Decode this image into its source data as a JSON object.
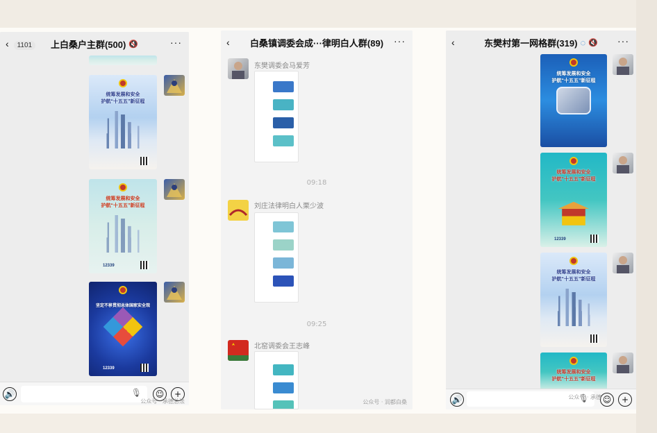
{
  "colors": {
    "background": "#f3eee6",
    "chat_bg": "#ededed",
    "nav_text": "#111111",
    "secondary_text": "#8a8a8a"
  },
  "left_chat": {
    "back_badge": "1101",
    "title": "上白桑户主群(500)",
    "more_label": "···",
    "posters": [
      {
        "style": "city",
        "line1": "统筹发展和安全",
        "line2": "护航“十五五”新征程"
      },
      {
        "style": "scroll",
        "line1": "统筹发展和安全",
        "line2": "护航“十五五”新征程",
        "hotline": "12339"
      },
      {
        "style": "cube",
        "line1": "坚定不移贯彻总体国家安全观",
        "hotline": "12339"
      }
    ],
    "watermark": "公众号 · 承德总法"
  },
  "mid_chat": {
    "title": "白桑镇调委会成···律明白人群(89)",
    "more_label": "···",
    "messages": [
      {
        "sender": "东樊调委会马爱芳"
      },
      {
        "time": "09:18"
      },
      {
        "sender": "刘庄法律明白人栗少波"
      },
      {
        "time": "09:25"
      },
      {
        "sender": "北窑调委会王志峰"
      }
    ],
    "watermark": "公众号 · 润都白桑"
  },
  "right_chat": {
    "title": "东樊村第一网格群(319)",
    "more_label": "···",
    "posters": [
      {
        "style": "robot",
        "line1": "统筹发展和安全",
        "line2": "护航“十五五”新征程"
      },
      {
        "style": "teal",
        "line1": "统筹发展和安全",
        "line2": "护航“十五五”新征程",
        "hotline": "12339"
      },
      {
        "style": "city",
        "line1": "统筹发展和安全",
        "line2": "护航“十五五”新征程"
      },
      {
        "style": "teal",
        "line1": "统筹发展和安全",
        "line2": "护航“十五五”新征程"
      }
    ],
    "watermark": "公众号 · 承德"
  },
  "icons": {
    "back": "chevron-left-icon",
    "more": "more-dots-icon",
    "voice": "voice-icon",
    "emoji": "emoji-icon",
    "add": "add-icon",
    "mute": "mute-icon",
    "loading": "loading-icon",
    "mic": "mic-icon"
  }
}
